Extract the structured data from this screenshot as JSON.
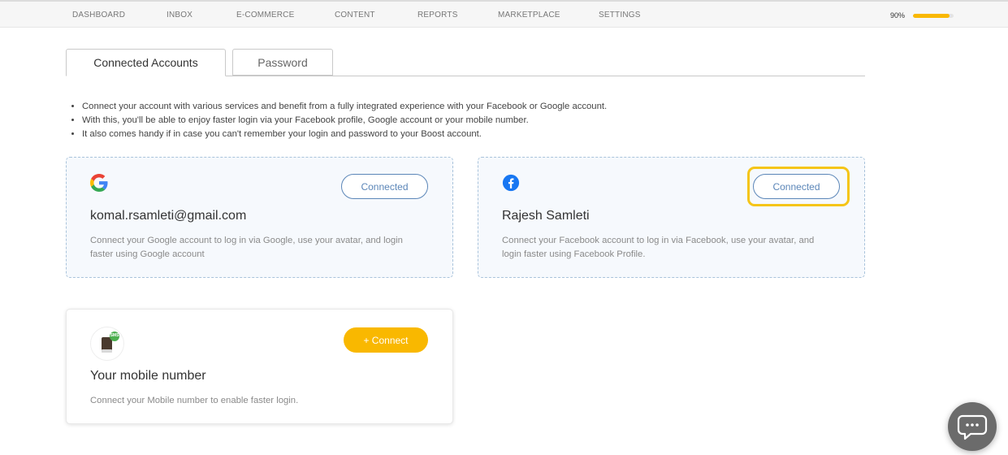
{
  "nav": {
    "items": [
      {
        "label": "DASHBOARD",
        "name": "dashboard"
      },
      {
        "label": "INBOX",
        "name": "inbox"
      },
      {
        "label": "E-COMMERCE",
        "name": "e-commerce"
      },
      {
        "label": "CONTENT",
        "name": "content"
      },
      {
        "label": "REPORTS",
        "name": "reports"
      },
      {
        "label": "MARKETPLACE",
        "name": "marketplace"
      },
      {
        "label": "SETTINGS",
        "name": "settings"
      }
    ],
    "progress_label": "90%",
    "progress_value": 0.9
  },
  "tabs": {
    "connected_accounts": "Connected Accounts",
    "password": "Password"
  },
  "info": [
    "Connect your account with various services and benefit from a fully integrated experience with your Facebook or Google account.",
    "With this, you'll be able to enjoy faster login via your Facebook profile, Google account or your mobile number.",
    "It also comes handy if in case you can't remember your login and password to your Boost account."
  ],
  "google": {
    "title": "komal.rsamleti@gmail.com",
    "description": "Connect your Google account to log in via Google, use your avatar, and login faster using Google account",
    "button": "Connected",
    "icon": "google-icon"
  },
  "facebook": {
    "title": "Rajesh Samleti",
    "description": "Connect your Facebook account to log in via Facebook, use your avatar, and login faster using Facebook Profile.",
    "button": "Connected",
    "icon": "facebook-icon"
  },
  "mobile": {
    "title": "Your mobile number",
    "description": "Connect your Mobile number to enable faster login.",
    "button": "+ Connect",
    "icon": "sms-phone-icon",
    "icon_badge": "SMS"
  },
  "colors": {
    "accent": "#f9b800",
    "link": "#5b86b8",
    "facebook": "#1877f2",
    "highlight": "#f5c518"
  }
}
